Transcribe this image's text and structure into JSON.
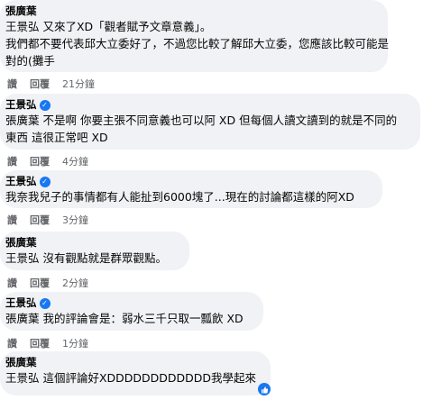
{
  "comments": [
    {
      "author": "張廣葉",
      "line1_mention": "王景弘",
      "line1_rest": " 又來了XD「觀者賦予文章意義」。",
      "line2": "我們都不要代表邱大立委好了，不過您比較了解邱大立委，您應該比較可能是",
      "line3": "對的(攤手",
      "like": "讚",
      "reply": "回覆",
      "time": "21分鐘"
    },
    {
      "author": "王景弘",
      "verified": true,
      "line1_mention": "張廣葉",
      "line1_rest": " 不是啊 你要主張不同意義也可以阿 XD 但每個人讀文讀到的就是不同的",
      "line2": "東西 這很正常吧 XD",
      "like": "讚",
      "reply": "回覆",
      "time": "4分鐘"
    },
    {
      "author": "王景弘",
      "verified": true,
      "line1": "我奈我兒子的事情都有人能扯到6000塊了...現在的討論都這樣的阿XD",
      "like": "讚",
      "reply": "回覆",
      "time": "3分鐘"
    },
    {
      "author": "張廣葉",
      "line1_mention": "王景弘",
      "line1_rest": " 沒有觀點就是群眾觀點。",
      "like": "讚",
      "reply": "回覆",
      "time": "2分鐘"
    },
    {
      "author": "王景弘",
      "verified": true,
      "line1_mention": "張廣葉",
      "line1_rest": " 我的評論會是：弱水三千只取一瓢飲 XD",
      "like": "讚",
      "reply": "回覆",
      "time": "1分鐘"
    },
    {
      "author": "張廣葉",
      "line1_mention": "王景弘",
      "line1_rest": " 這個評論好XDDDDDDDDDDDD我學起來"
    }
  ],
  "icons": {
    "verified": "verified-badge-icon",
    "like_reaction": "thumbs-up-icon"
  },
  "colors": {
    "bubble": "#f0f2f5",
    "meta": "#65676b",
    "accent": "#1877f2"
  }
}
